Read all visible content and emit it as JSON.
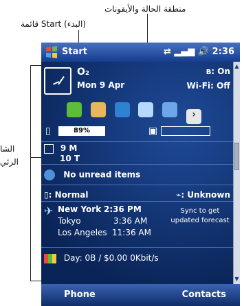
{
  "annotations": {
    "status_area": "منطقة الحالة والأيقونات",
    "start_menu": "قائمة Start (البدء)",
    "screen_left": "الشا",
    "screen_left_2": "الرئي"
  },
  "title_bar": {
    "start_label": "Start",
    "status_text": "2:36"
  },
  "today": {
    "owner": "O₂",
    "date": "Mon 9 Apr",
    "bluetooth": "On",
    "wifi": "Wi-Fi: Off",
    "battery_percent": "89%",
    "day_1": "9 M",
    "day_2": "10 T",
    "messages": "No unread items",
    "profile": "Normal",
    "location": "Unknown",
    "city_1": "New York",
    "time_1": "2:36 PM",
    "city_2": "Tokyo",
    "time_2": "3:36 AM",
    "city_3": "Los Angeles",
    "time_3": "11:36 AM",
    "weather": "Sync to get updated forecast",
    "traffic": "Day: 0B / $0.00 0Kbit/s"
  },
  "softkeys": {
    "left": "Phone",
    "right": "Contacts"
  }
}
